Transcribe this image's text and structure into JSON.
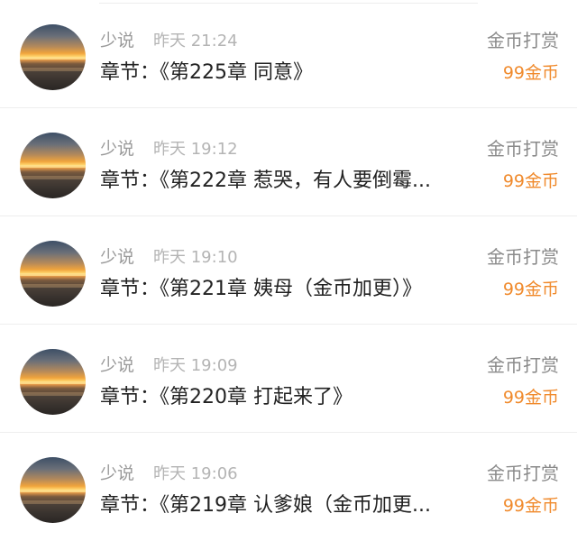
{
  "records": [
    {
      "user": "少说",
      "time": "昨天 21:24",
      "chapter": "章节：《第225章 同意》",
      "action": "金币打赏",
      "price": "99金币"
    },
    {
      "user": "少说",
      "time": "昨天 19:12",
      "chapter": "章节：《第222章  惹哭，有人要倒霉...",
      "action": "金币打赏",
      "price": "99金币"
    },
    {
      "user": "少说",
      "time": "昨天 19:10",
      "chapter": "章节：《第221章  姨母（金币加更）》",
      "action": "金币打赏",
      "price": "99金币"
    },
    {
      "user": "少说",
      "time": "昨天 19:09",
      "chapter": "章节：《第220章 打起来了》",
      "action": "金币打赏",
      "price": "99金币"
    },
    {
      "user": "少说",
      "time": "昨天 19:06",
      "chapter": "章节：《第219章  认爹娘（金币加更...",
      "action": "金币打赏",
      "price": "99金币"
    }
  ],
  "colors": {
    "price": "#f08a2c",
    "secondary_text": "#9a9a9a",
    "primary_text": "#222222",
    "divider": "#eeeeee"
  }
}
